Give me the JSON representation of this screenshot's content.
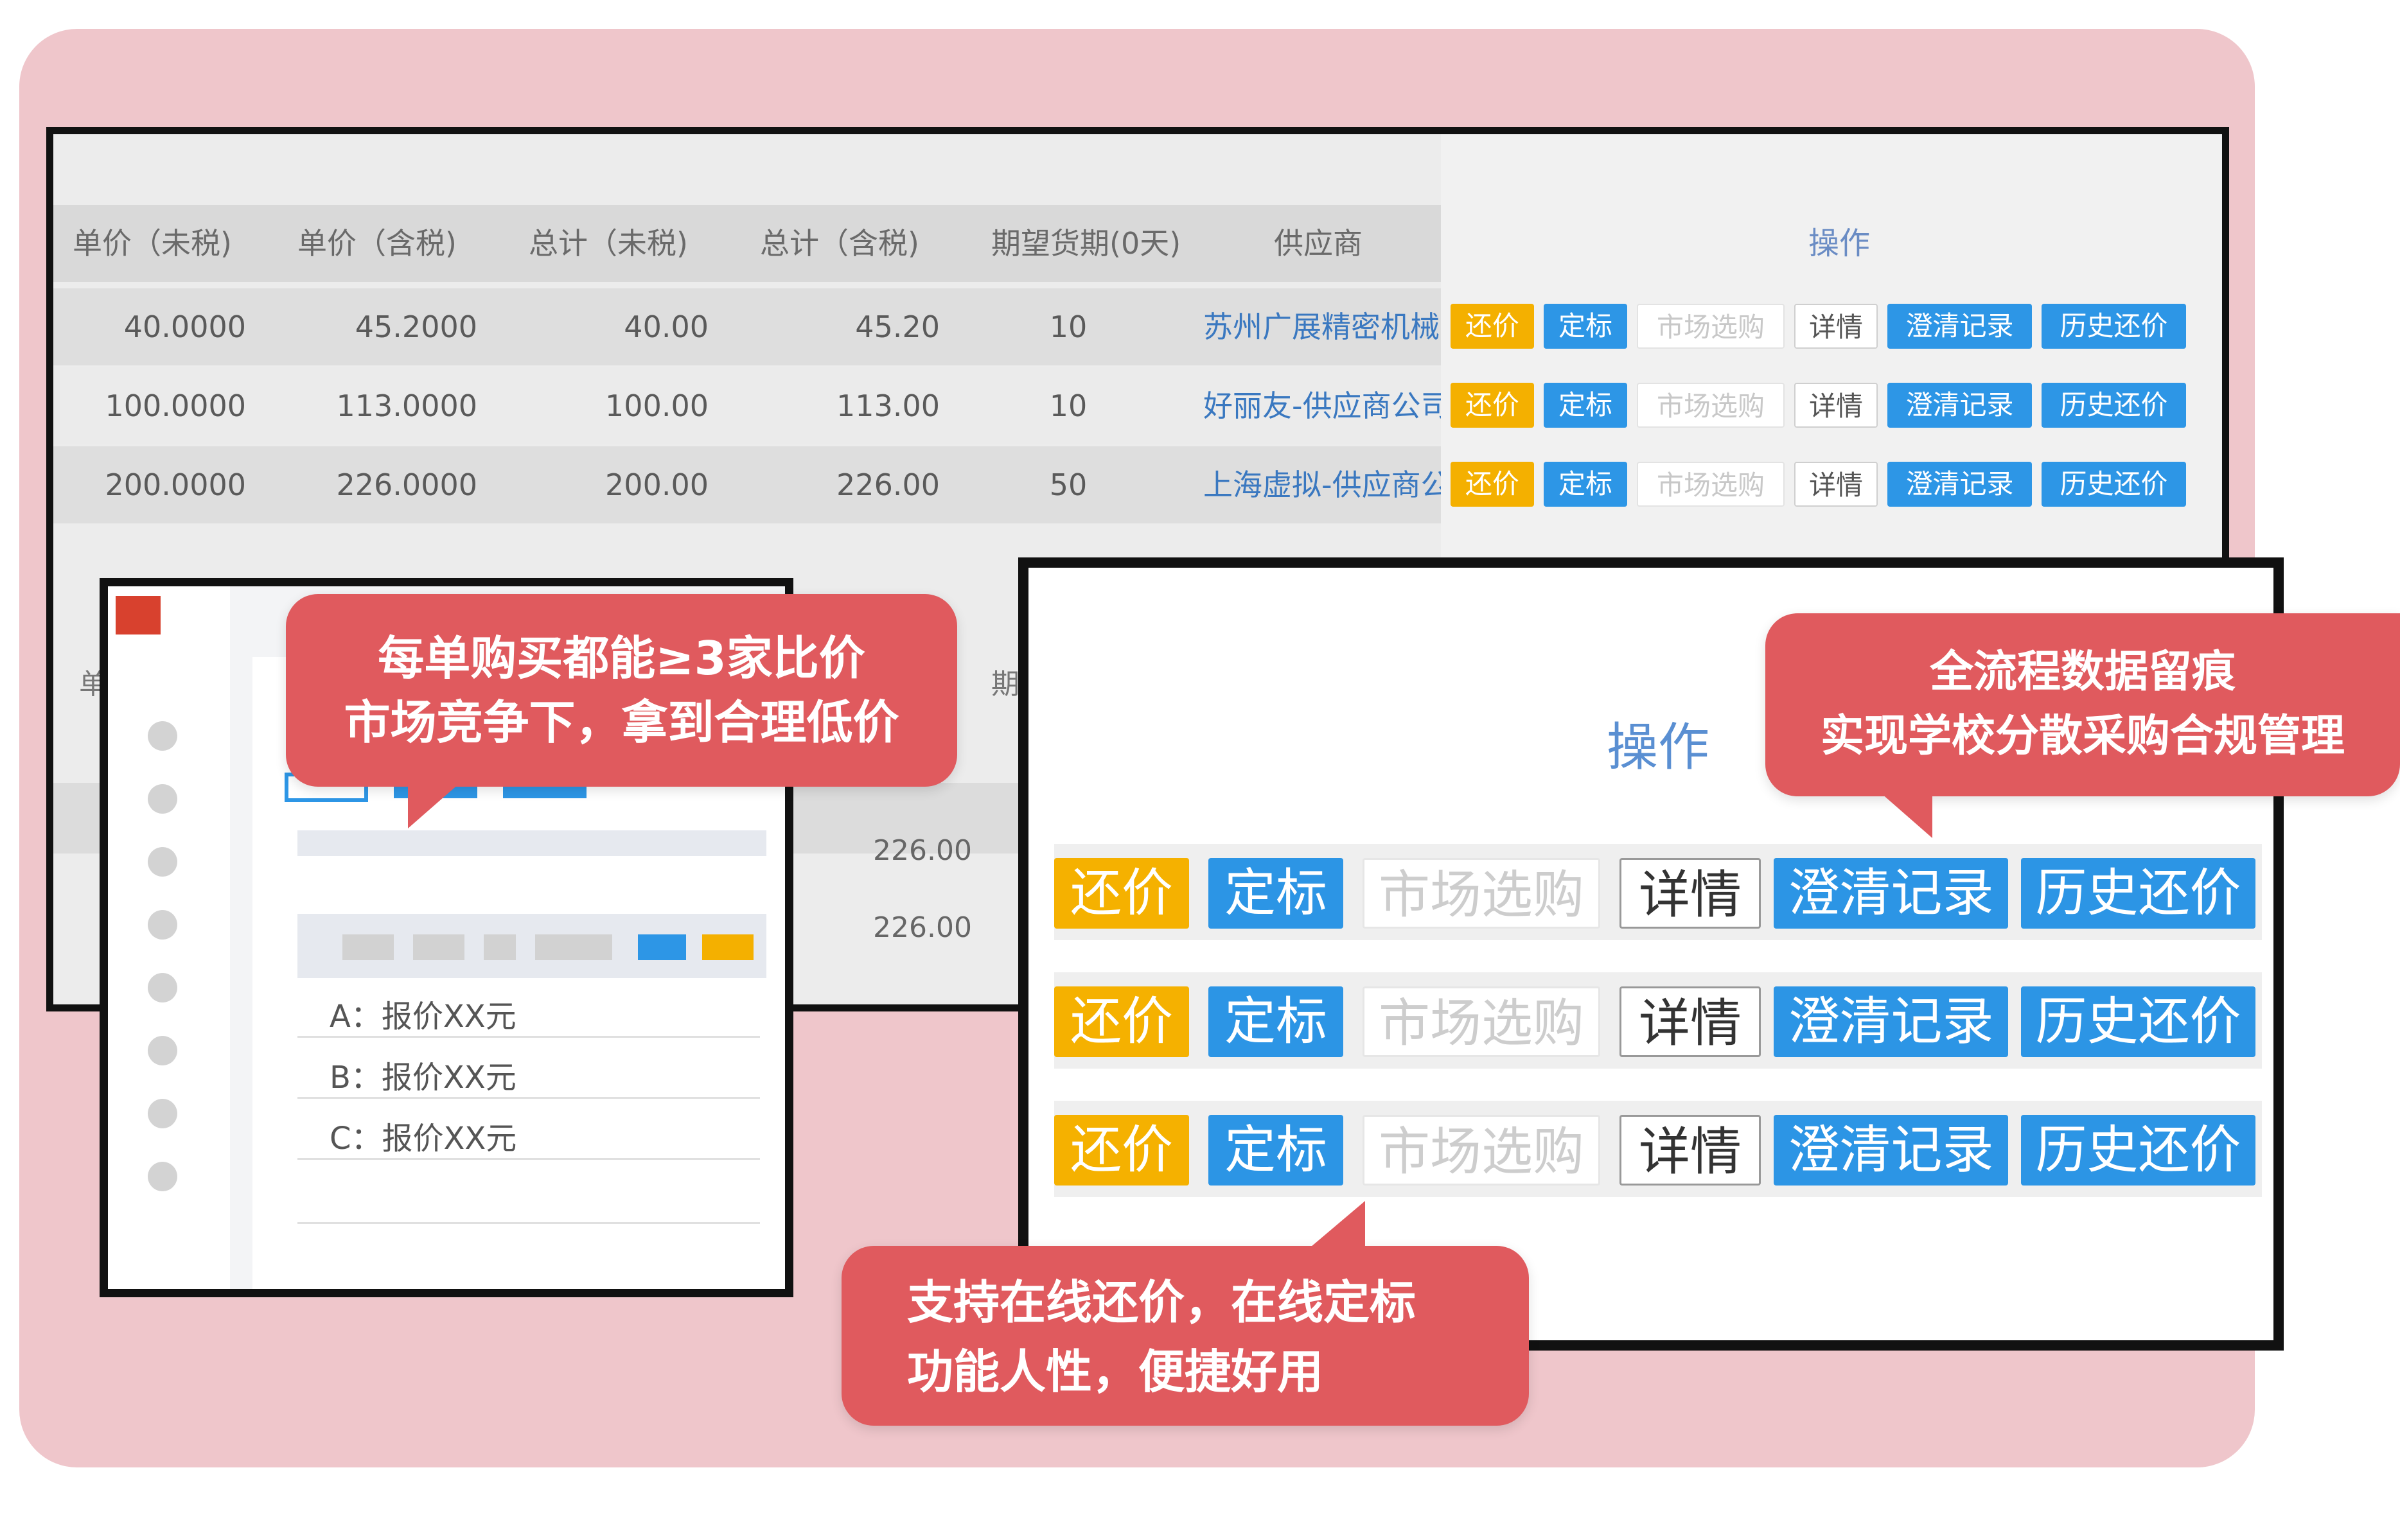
{
  "back_table": {
    "headers": [
      "单价（未税)",
      "单价（含税)",
      "总计（未税)",
      "总计（含税)",
      "期望货期(0天)",
      "供应商"
    ],
    "ops_header": "操作",
    "rows": [
      {
        "unit_excl": "40.0000",
        "unit_incl": "45.2000",
        "total_excl": "40.00",
        "total_incl": "45.20",
        "days": "10",
        "supplier": "苏州广展精密机械"
      },
      {
        "unit_excl": "100.0000",
        "unit_incl": "113.0000",
        "total_excl": "100.00",
        "total_incl": "113.00",
        "days": "10",
        "supplier": "好丽友-供应商公司"
      },
      {
        "unit_excl": "200.0000",
        "unit_incl": "226.0000",
        "total_excl": "200.00",
        "total_incl": "226.00",
        "days": "50",
        "supplier": "上海虚拟-供应商公司"
      }
    ],
    "buttons": {
      "counter_offer": "还价",
      "award": "定标",
      "market_buy": "市场选购",
      "details": "详情",
      "clarify_record": "澄清记录",
      "history_counter": "历史还价"
    },
    "partial_header_left": "单",
    "partial_header_mid": "期",
    "lower_values": [
      "226.00",
      "226.00"
    ]
  },
  "left_window": {
    "options": [
      "A：报价XX元",
      "B：报价XX元",
      "C：报价XX元"
    ]
  },
  "right_window": {
    "title": "操作",
    "buttons": {
      "counter_offer": "还价",
      "award": "定标",
      "market_buy": "市场选购",
      "details": "详情",
      "clarify_record": "澄清记录",
      "history_counter": "历史还价"
    }
  },
  "callouts": {
    "compare": [
      "每单购买都能≥3家比价",
      "市场竞争下，拿到合理低价"
    ],
    "trace": [
      "全流程数据留痕",
      "实现学校分散采购合规管理"
    ],
    "online": [
      "支持在线还价，在线定标",
      "功能人性，便捷好用"
    ]
  },
  "colors": {
    "background_panel": "#efc6cb",
    "callout": "#e05a5e",
    "orange_button": "#f5b100",
    "blue_button": "#2c95e5",
    "link": "#3a78c0"
  }
}
